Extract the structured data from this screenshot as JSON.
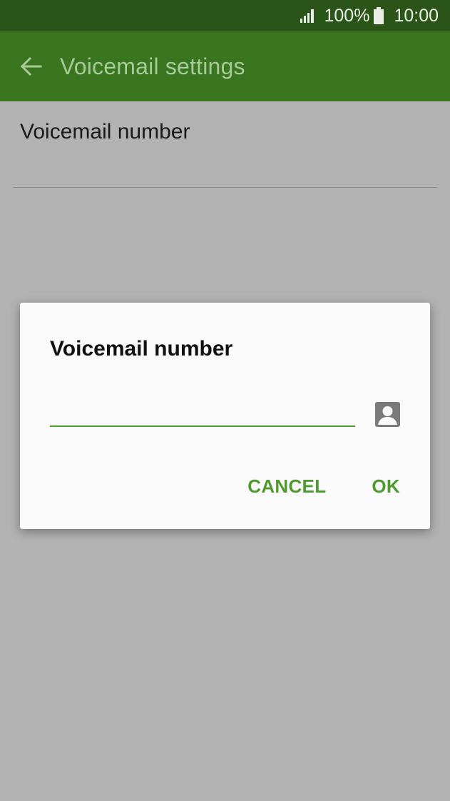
{
  "status_bar": {
    "battery_percent": "100%",
    "time": "10:00",
    "icons": [
      "signal-icon",
      "battery-icon"
    ]
  },
  "app_bar": {
    "title": "Voicemail settings",
    "back_icon": "back-arrow-icon"
  },
  "settings_list": {
    "items": [
      {
        "label": "Voicemail number"
      }
    ]
  },
  "dialog": {
    "title": "Voicemail number",
    "input_value": "",
    "contact_icon": "contact-icon",
    "cancel_label": "CANCEL",
    "ok_label": "OK"
  },
  "colors": {
    "status_bar": "#2b5518",
    "app_bar": "#3a7520",
    "accent": "#4e9a2e",
    "scrim_background": "#b2b2b2",
    "dialog_background": "#fafafa"
  }
}
